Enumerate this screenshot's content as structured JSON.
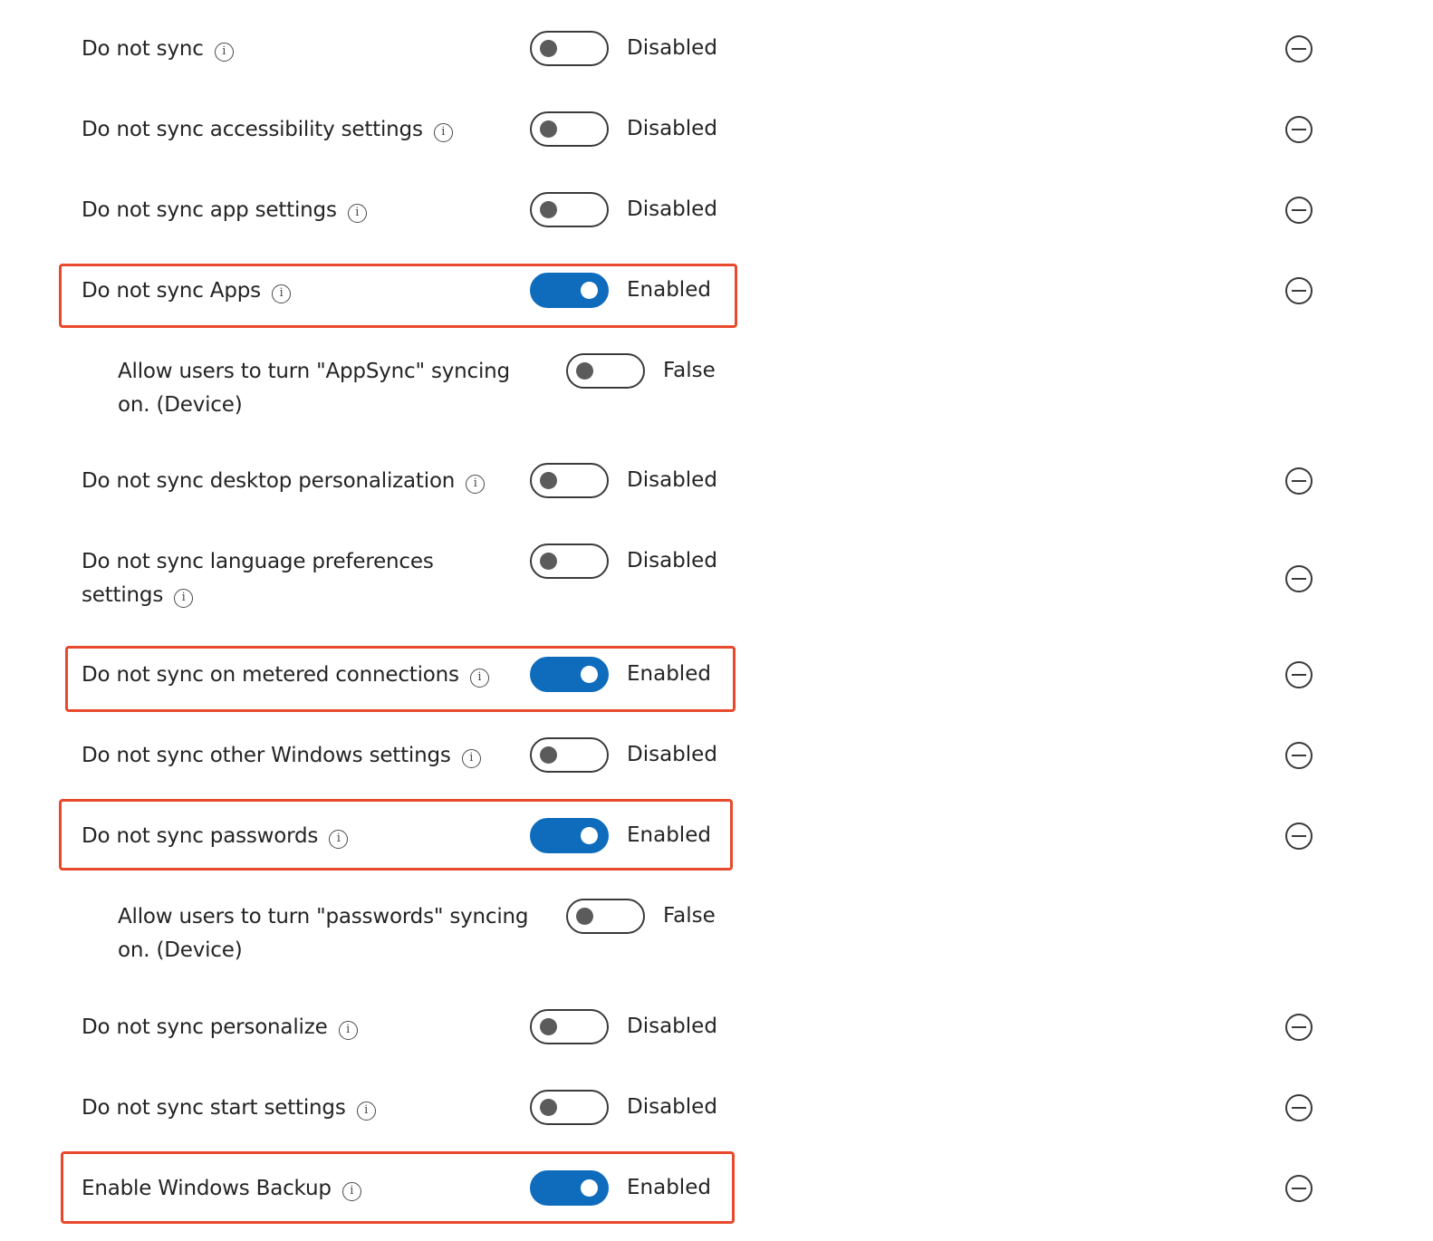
{
  "settings": [
    {
      "label": "Do not sync",
      "state": "Disabled",
      "enabled": false
    },
    {
      "label": "Do not sync accessibility settings",
      "state": "Disabled",
      "enabled": false
    },
    {
      "label": "Do not sync app settings",
      "state": "Disabled",
      "enabled": false
    },
    {
      "label": "Do not sync Apps",
      "state": "Enabled",
      "enabled": true,
      "highlighted": true
    },
    {
      "label": "Allow users to turn \"AppSync\" syncing on. (Device)",
      "state": "False",
      "enabled": false
    },
    {
      "label": "Do not sync desktop personalization",
      "state": "Disabled",
      "enabled": false
    },
    {
      "label": "Do not sync language preferences settings",
      "state": "Disabled",
      "enabled": false
    },
    {
      "label": "Do not sync on metered connections",
      "state": "Enabled",
      "enabled": true,
      "highlighted": true
    },
    {
      "label": "Do not sync other Windows settings",
      "state": "Disabled",
      "enabled": false
    },
    {
      "label": "Do not sync passwords",
      "state": "Enabled",
      "enabled": true,
      "highlighted": true
    },
    {
      "label": "Allow users to turn \"passwords\" syncing on. (Device)",
      "state": "False",
      "enabled": false
    },
    {
      "label": "Do not sync personalize",
      "state": "Disabled",
      "enabled": false
    },
    {
      "label": "Do not sync start settings",
      "state": "Disabled",
      "enabled": false
    },
    {
      "label": "Enable Windows Backup",
      "state": "Enabled",
      "enabled": true,
      "highlighted": true
    }
  ],
  "info_glyph": "i",
  "icons": {
    "info": "info-icon",
    "remove": "remove-circle-icon"
  },
  "colors": {
    "toggle_on": "#0f6cbd",
    "highlight_border": "#e8492c"
  }
}
